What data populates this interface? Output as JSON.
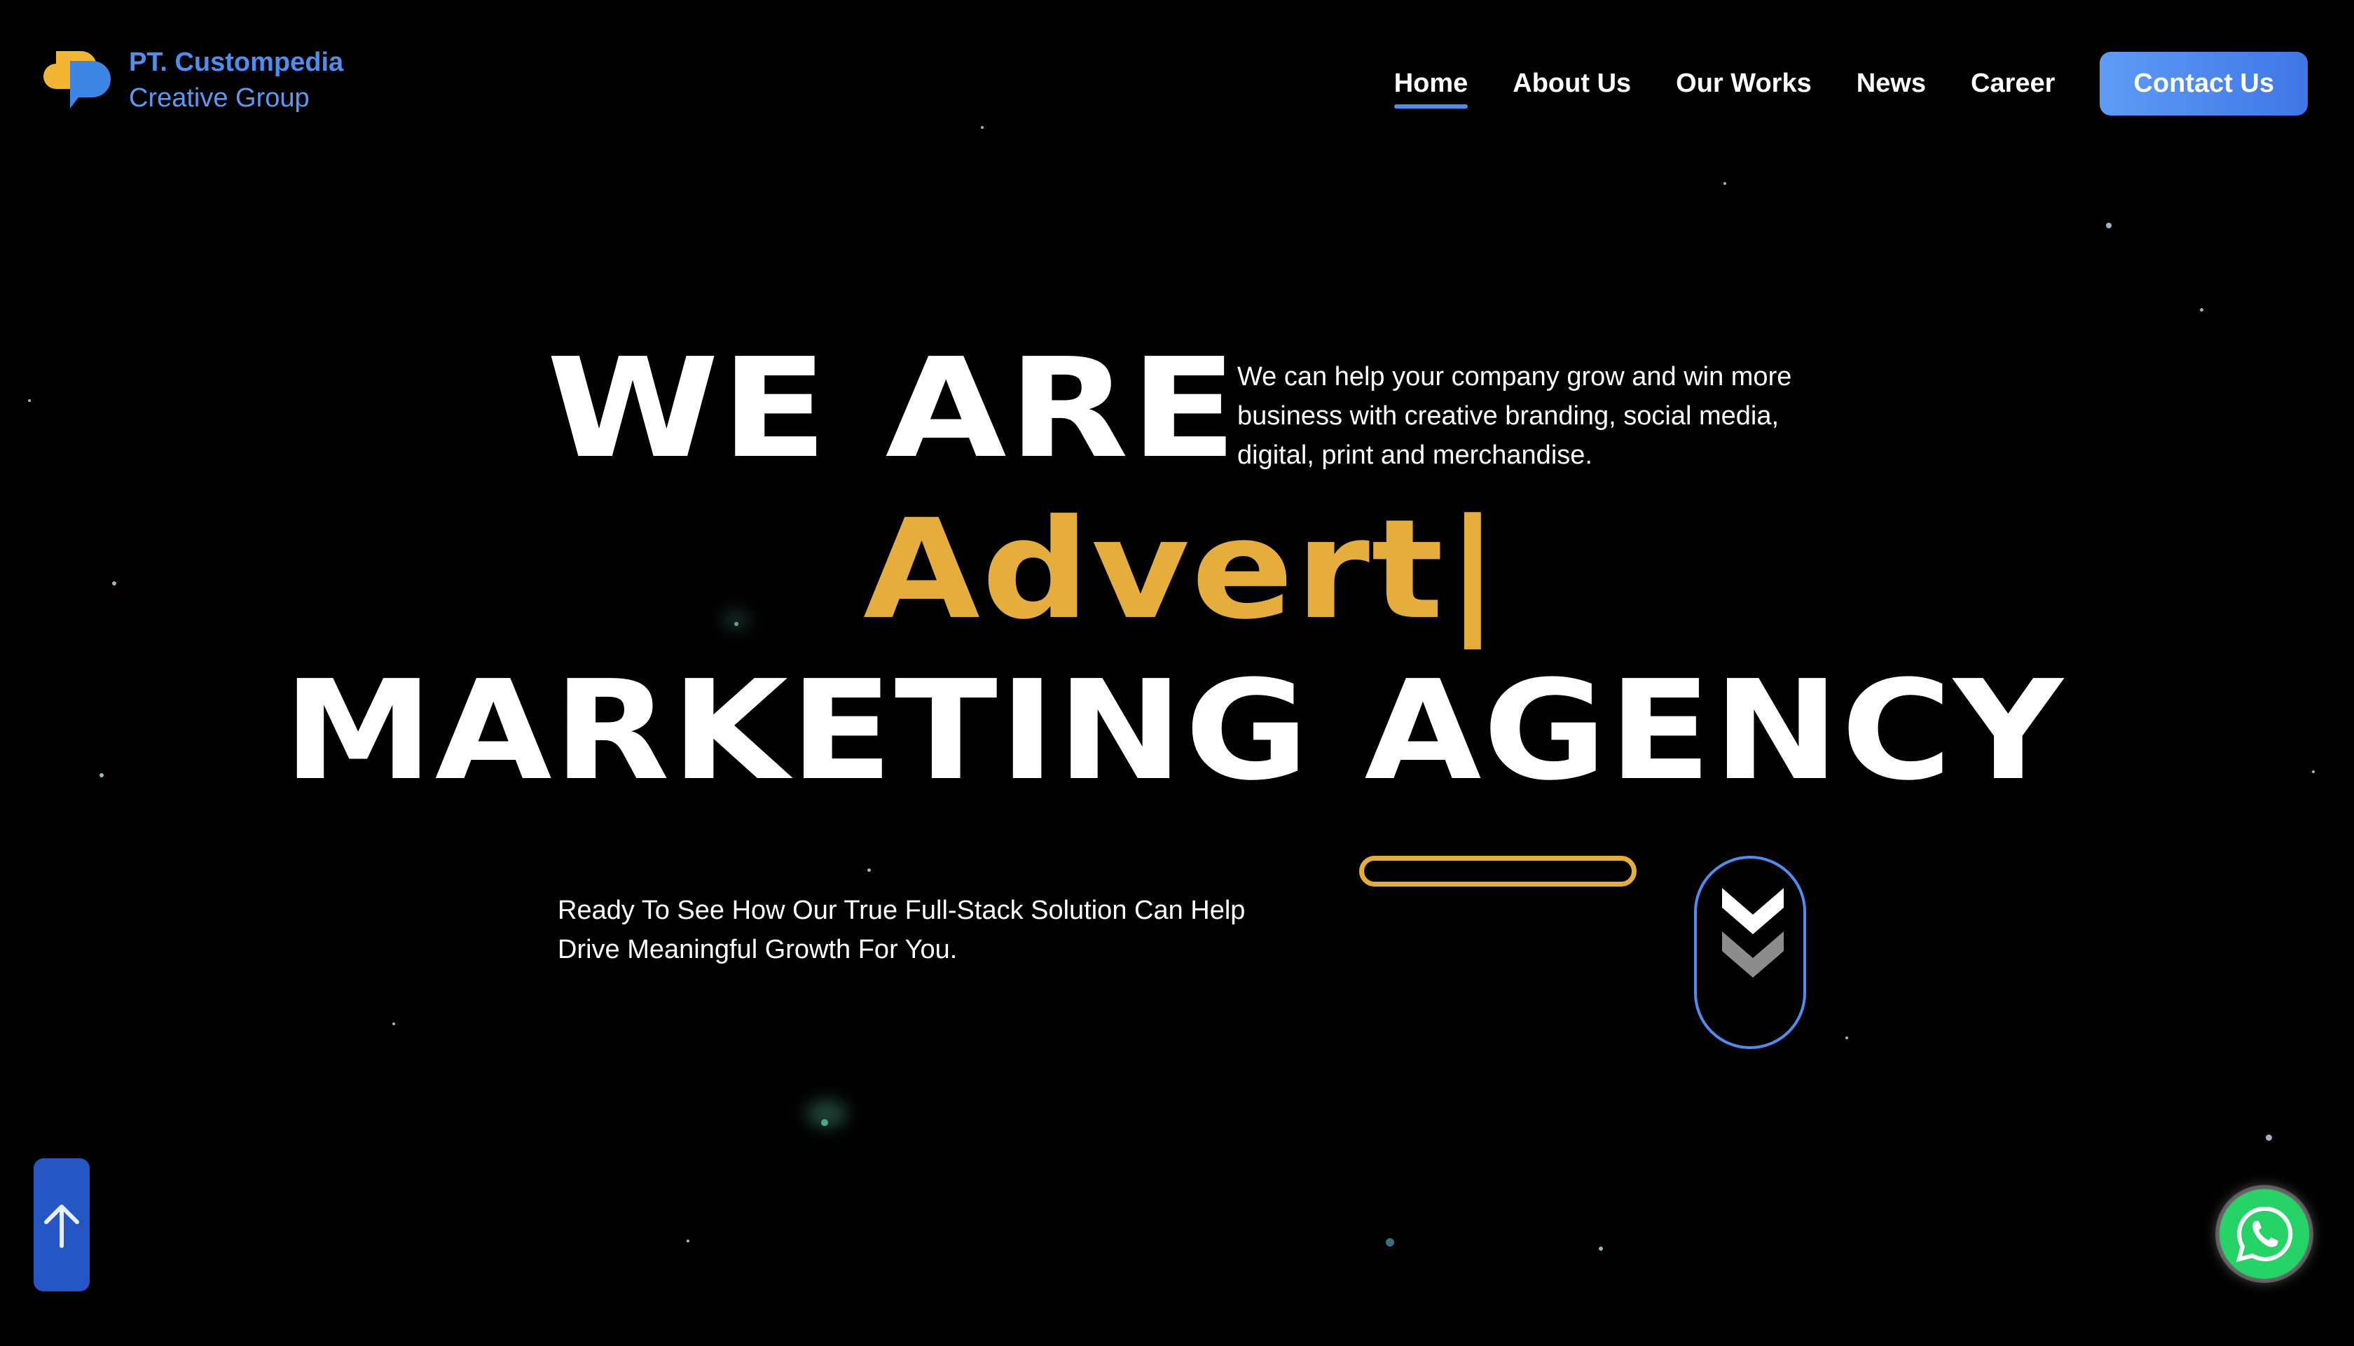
{
  "brand": {
    "name": "PT. Custompedia",
    "tagline": "Creative Group",
    "colors": {
      "primary": "#4d8ef0",
      "accent": "#e5ae3c",
      "logo_yellow": "#f2b634"
    }
  },
  "nav": {
    "items": [
      {
        "label": "Home",
        "active": true
      },
      {
        "label": "About Us",
        "active": false
      },
      {
        "label": "Our Works",
        "active": false
      },
      {
        "label": "News",
        "active": false
      },
      {
        "label": "Career",
        "active": false
      }
    ],
    "contact_label": "Contact Us"
  },
  "hero": {
    "line1": "WE ARE",
    "typed_word": "Advert|",
    "line3": "MARKETING AGENCY",
    "description": "We can help your company grow and win more business with creative branding, social media, digital, print and merchandise.",
    "cta_text": "Ready To See How Our True Full-Stack Solution Can Help Drive Meaningful Growth For You."
  },
  "icons": {
    "scroll_down": "double-chevron-down-icon",
    "back_to_top": "arrow-up-icon",
    "whatsapp": "whatsapp-icon"
  }
}
